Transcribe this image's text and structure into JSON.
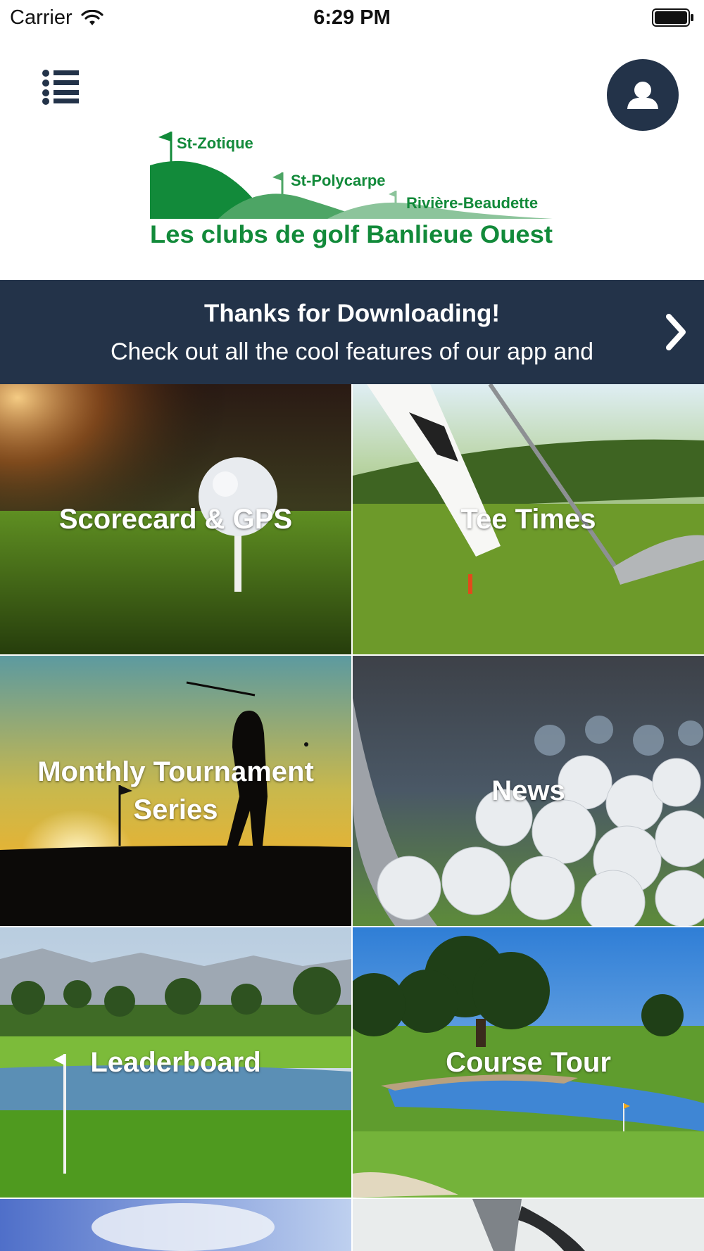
{
  "status_bar": {
    "carrier": "Carrier",
    "time": "6:29 PM"
  },
  "header": {
    "logo": {
      "course_1": "St-Zotique",
      "course_2": "St-Polycarpe",
      "course_3": "Rivière-Beaudette",
      "name": "Les clubs de golf Banlieue Ouest",
      "colors": {
        "dark_green": "#128a3a",
        "mid_green": "#4da565",
        "light_green": "#8cc49b"
      }
    },
    "menu_icon": "list-icon",
    "profile_icon": "person-icon"
  },
  "banner": {
    "title": "Thanks for Downloading!",
    "text": "Check out all the cool features of our app and",
    "arrow_icon": "chevron-right-icon",
    "background": "#233349"
  },
  "tiles": [
    {
      "label": "Scorecard & GPS"
    },
    {
      "label": "Tee Times"
    },
    {
      "label": "Monthly Tournament Series"
    },
    {
      "label": "News"
    },
    {
      "label": "Leaderboard"
    },
    {
      "label": "Course Tour"
    }
  ]
}
